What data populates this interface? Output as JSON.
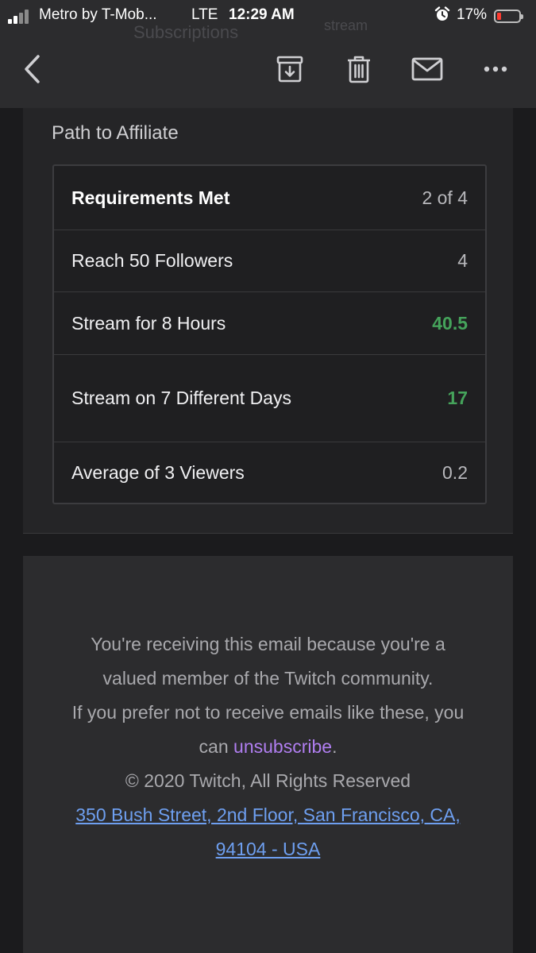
{
  "status_bar": {
    "carrier": "Metro by T-Mob...",
    "network": "LTE",
    "time": "12:29 AM",
    "battery_percent": "17%",
    "battery_level": 0.17,
    "icons": [
      "signal-icon",
      "alarm-icon",
      "battery-icon"
    ]
  },
  "background_peek": {
    "left_text": "Subscriptions",
    "right_text": "stream"
  },
  "toolbar": {
    "icons": [
      "back-chevron-icon",
      "archive-icon",
      "trash-icon",
      "mail-icon",
      "more-icon"
    ]
  },
  "affiliate": {
    "title": "Path to Affiliate",
    "header": {
      "label": "Requirements Met",
      "value": "2 of 4"
    },
    "rows": [
      {
        "label": "Reach 50 Followers",
        "value": "4",
        "met": false
      },
      {
        "label": "Stream for 8 Hours",
        "value": "40.5",
        "met": true
      },
      {
        "label": "Stream on 7 Different Days",
        "value": "17",
        "met": true
      },
      {
        "label": "Average of 3 Viewers",
        "value": "0.2",
        "met": false
      }
    ]
  },
  "footer": {
    "line1": "You're receiving this email because you're a valued member of the Twitch community.",
    "line2_prefix": "If you prefer not to receive emails like these, you can ",
    "unsubscribe": "unsubscribe",
    "line2_suffix": ".",
    "copyright": "© 2020 Twitch, All Rights Reserved",
    "address": "350 Bush Street, 2nd Floor, San Francisco, CA, 94104 - USA"
  },
  "colors": {
    "met_green": "#45a35b",
    "link_blue": "#6e9ff0",
    "unsubscribe_purple": "#b07ef0",
    "battery_red": "#ff3b30"
  }
}
